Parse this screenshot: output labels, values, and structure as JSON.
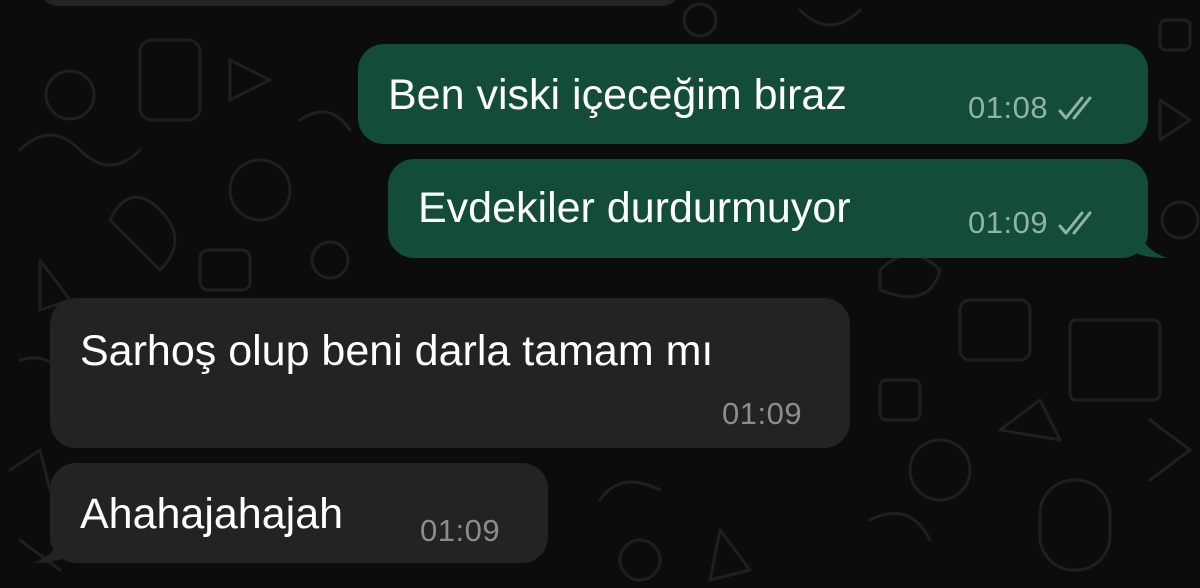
{
  "chat": {
    "messages": [
      {
        "direction": "outgoing",
        "text": "Ben viski içeceğim biraz",
        "time": "01:08",
        "status": "read-ticks-icon"
      },
      {
        "direction": "outgoing",
        "text": "Evdekiler durdurmuyor",
        "time": "01:09",
        "status": "read-ticks-icon"
      },
      {
        "direction": "incoming",
        "text": "Sarhoş olup beni darla tamam mı",
        "time": "01:09"
      },
      {
        "direction": "incoming",
        "text": "Ahahajahajah",
        "time": "01:09"
      }
    ]
  },
  "colors": {
    "background": "#0c0c0c",
    "outgoing_bubble": "#134d37",
    "incoming_bubble": "#232323",
    "wallpaper_doodle": "#1e1e1e",
    "tick": "#8fb3a5"
  }
}
